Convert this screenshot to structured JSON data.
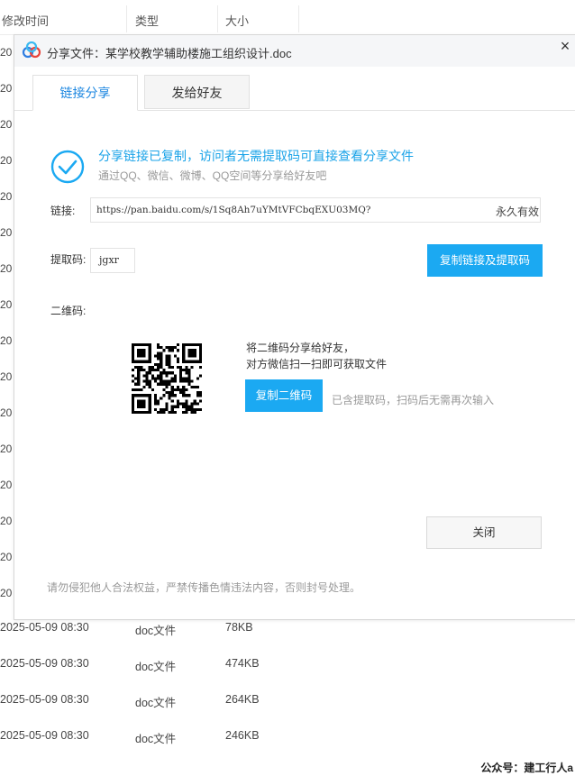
{
  "background": {
    "columns": {
      "modified": "修改时间",
      "type": "类型",
      "size": "大小"
    },
    "year_prefix": "20",
    "rows": [
      {
        "date": "2025-05-09 08:30",
        "type": "doc文件",
        "size": "78KB"
      },
      {
        "date": "2025-05-09 08:30",
        "type": "doc文件",
        "size": "474KB"
      },
      {
        "date": "2025-05-09 08:30",
        "type": "doc文件",
        "size": "264KB"
      },
      {
        "date": "2025-05-09 08:30",
        "type": "doc文件",
        "size": "246KB"
      }
    ],
    "watermark": "公众号：建工行人a"
  },
  "dialog": {
    "title": "分享文件：某学校教学辅助楼施工组织设计.doc",
    "close_icon": "×",
    "tabs": [
      {
        "label": "链接分享",
        "active": true
      },
      {
        "label": "发给好友",
        "active": false
      }
    ],
    "success": {
      "title": "分享链接已复制，访问者无需提取码可直接查看分享文件",
      "subtitle": "通过QQ、微信、微博、QQ空间等分享给好友吧"
    },
    "link_label": "链接:",
    "link_url": "https://pan.baidu.com/s/1Sq8Ah7uYMtVFCbqEXU03MQ?",
    "link_validity": "永久有效",
    "code_label": "提取码:",
    "code_value": "jgxr",
    "copy_link_button": "复制链接及提取码",
    "qr_label": "二维码:",
    "qr_text_1": "将二维码分享给好友，",
    "qr_text_2": "对方微信扫一扫即可获取文件",
    "copy_qr_button": "复制二维码",
    "qr_hint": "已含提取码，扫码后无需再次输入",
    "close_button": "关闭",
    "notice": "请勿侵犯他人合法权益，严禁传播色情违法内容，否则封号处理。"
  },
  "colors": {
    "accent": "#1ba9f2",
    "tab_active": "#1b86e0",
    "muted": "#999999"
  }
}
